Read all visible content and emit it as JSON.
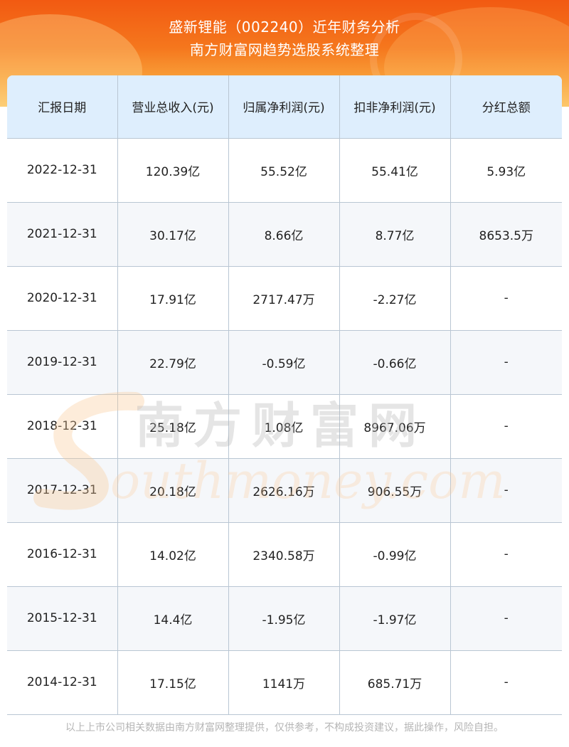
{
  "header": {
    "title_line1": "盛新锂能（002240）近年财务分析",
    "title_line2": "南方财富网趋势选股系统整理"
  },
  "table": {
    "columns": [
      "汇报日期",
      "营业总收入(元)",
      "归属净利润(元)",
      "扣非净利润(元)",
      "分红总额"
    ],
    "rows": [
      [
        "2022-12-31",
        "120.39亿",
        "55.52亿",
        "55.41亿",
        "5.93亿"
      ],
      [
        "2021-12-31",
        "30.17亿",
        "8.66亿",
        "8.77亿",
        "8653.5万"
      ],
      [
        "2020-12-31",
        "17.91亿",
        "2717.47万",
        "-2.27亿",
        "-"
      ],
      [
        "2019-12-31",
        "22.79亿",
        "-0.59亿",
        "-0.66亿",
        "-"
      ],
      [
        "2018-12-31",
        "25.18亿",
        "1.08亿",
        "8967.06万",
        "-"
      ],
      [
        "2017-12-31",
        "20.18亿",
        "2626.16万",
        "906.55万",
        "-"
      ],
      [
        "2016-12-31",
        "14.02亿",
        "2340.58万",
        "-0.99亿",
        "-"
      ],
      [
        "2015-12-31",
        "14.4亿",
        "-1.95亿",
        "-1.97亿",
        "-"
      ],
      [
        "2014-12-31",
        "17.15亿",
        "1141万",
        "685.71万",
        "-"
      ]
    ]
  },
  "watermark": {
    "cn": "南方财富网",
    "en": "outhmoney.com"
  },
  "footer": {
    "disclaimer": "以上上市公司相关数据由南方财富网整理提供，仅供参考，不构成投资建议，据此操作，风险自担。"
  },
  "colors": {
    "header_orange": "#f25a12",
    "table_header_bg": "#deeefd",
    "grid_line": "#b9c6d3"
  }
}
